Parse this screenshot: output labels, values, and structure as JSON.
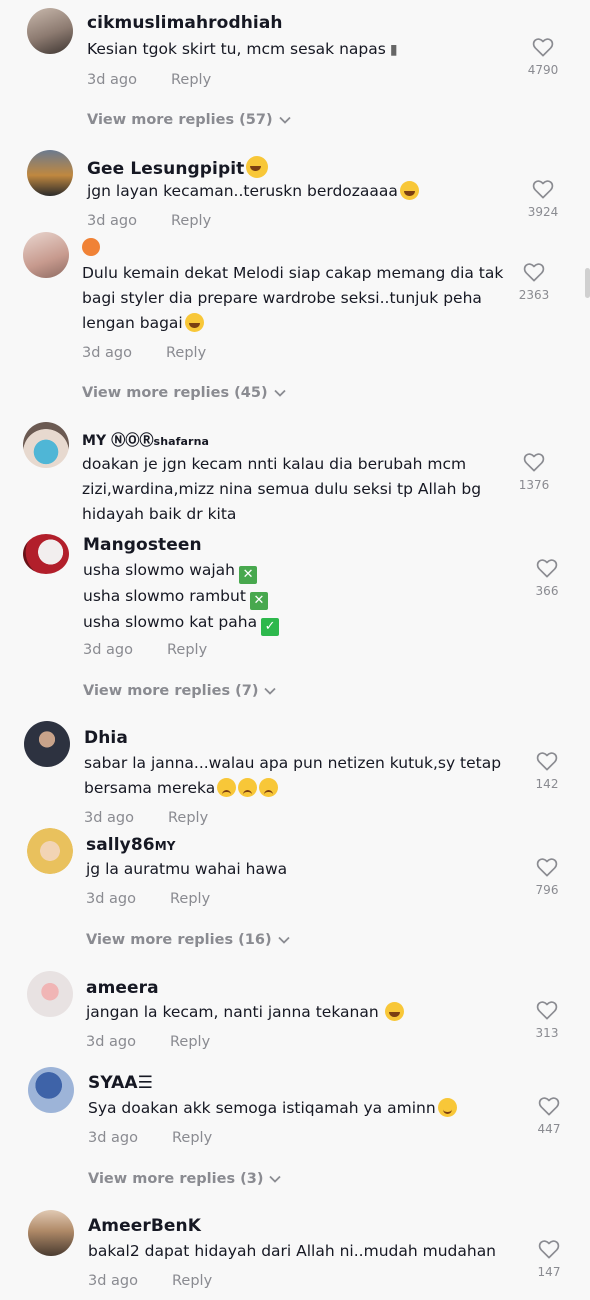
{
  "comments": [
    {
      "username": "cikmuslimahrodhiah",
      "text_lines": [
        "Kesian tgok skirt tu, mcm sesak napas"
      ],
      "time": "3d ago",
      "reply_label": "Reply",
      "likes": "4790",
      "view_more": "View more replies (57)"
    },
    {
      "username": "Gee Lesungpipit",
      "text_lines": [
        "jgn layan kecaman..teruskn berdozaaaa"
      ],
      "time": "3d ago",
      "reply_label": "Reply",
      "likes": "3924"
    },
    {
      "username": "",
      "text_lines": [
        "Dulu kemain dekat Melodi siap cakap memang dia tak",
        "bagi styler dia prepare wardrobe seksi..tunjuk peha",
        "lengan bagai"
      ],
      "time": "3d ago",
      "reply_label": "Reply",
      "likes": "2363",
      "view_more": "View more replies (45)"
    },
    {
      "username": "MY ⓃⓄⓇ",
      "username_suffix": "shafarna",
      "text_lines": [
        "doakan je jgn kecam nnti kalau dia berubah mcm",
        "zizi,wardina,mizz nina semua dulu seksi tp Allah bg",
        "hidayah baik dr kita"
      ],
      "likes": "1376"
    },
    {
      "username": "Mangosteen",
      "text_lines": [
        "usha slowmo wajah",
        "usha slowmo rambut",
        "usha slowmo kat paha"
      ],
      "time": "3d ago",
      "reply_label": "Reply",
      "likes": "366",
      "view_more": "View more replies (7)"
    },
    {
      "username": "Dhia",
      "text_lines": [
        "sabar la janna...walau apa pun netizen kutuk,sy tetap",
        "bersama mereka"
      ],
      "time": "3d ago",
      "reply_label": "Reply",
      "likes": "142"
    },
    {
      "username": "sally86",
      "username_suffix": "MY",
      "text_lines": [
        "jg la auratmu wahai hawa"
      ],
      "time": "3d ago",
      "reply_label": "Reply",
      "likes": "796",
      "view_more": "View more replies (16)"
    },
    {
      "username": "ameera",
      "text_lines": [
        "jangan la kecam, nanti janna tekanan"
      ],
      "time": "3d ago",
      "reply_label": "Reply",
      "likes": "313"
    },
    {
      "username": "SYAA☰",
      "text_lines": [
        "Sya doakan akk semoga istiqamah ya aminn"
      ],
      "time": "3d ago",
      "reply_label": "Reply",
      "likes": "447",
      "view_more": "View more replies (3)"
    },
    {
      "username": "AmeerBenK",
      "text_lines": [
        "bakal2 dapat hidayah dari Allah ni..mudah mudahan"
      ],
      "time": "3d ago",
      "reply_label": "Reply",
      "likes": "147"
    }
  ],
  "colors": {
    "background": "#f8f8f8",
    "text": "#161823",
    "secondary": "#8a8b91"
  },
  "icons": {
    "like": "heart-outline-icon",
    "expand": "chevron-down-icon"
  }
}
